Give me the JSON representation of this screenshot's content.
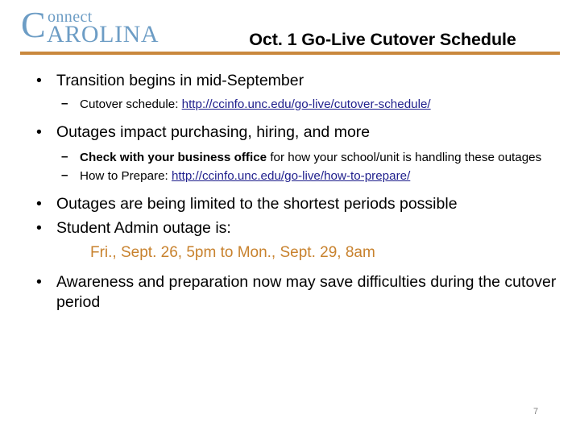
{
  "slide": {
    "page_number": "7",
    "accent_rule_color": "#c9883d",
    "logo": {
      "big_letter": "C",
      "line1": "onnect",
      "line2": "AROLINA",
      "color": "#6d9dc5"
    },
    "title": "Oct. 1 Go-Live Cutover Schedule"
  },
  "content": {
    "b1": {
      "marker": "•",
      "text": "Transition begins in mid-September"
    },
    "b1_sub1": {
      "marker": "–",
      "label": "Cutover schedule: ",
      "link": "http://ccinfo.unc.edu/go-live/cutover-schedule/"
    },
    "b2": {
      "marker": "•",
      "text": "Outages impact purchasing, hiring, and more"
    },
    "b2_sub1": {
      "marker": "–",
      "bold_text": "Check with your business office",
      "rest_text": " for how your school/unit is handling these outages"
    },
    "b2_sub2": {
      "marker": "–",
      "label": "How to Prepare: ",
      "link": "http://ccinfo.unc.edu/go-live/how-to-prepare/"
    },
    "b3": {
      "marker": "•",
      "text": "Outages are being limited to the shortest periods possible"
    },
    "b4": {
      "marker": "•",
      "text": "Student Admin outage is:"
    },
    "date_line": {
      "text": "Fri., Sept. 26, 5pm to Mon., Sept. 29, 8am",
      "color": "#c8822e"
    },
    "b5": {
      "marker": "•",
      "text": "Awareness and preparation now may save difficulties during the cutover period"
    }
  }
}
